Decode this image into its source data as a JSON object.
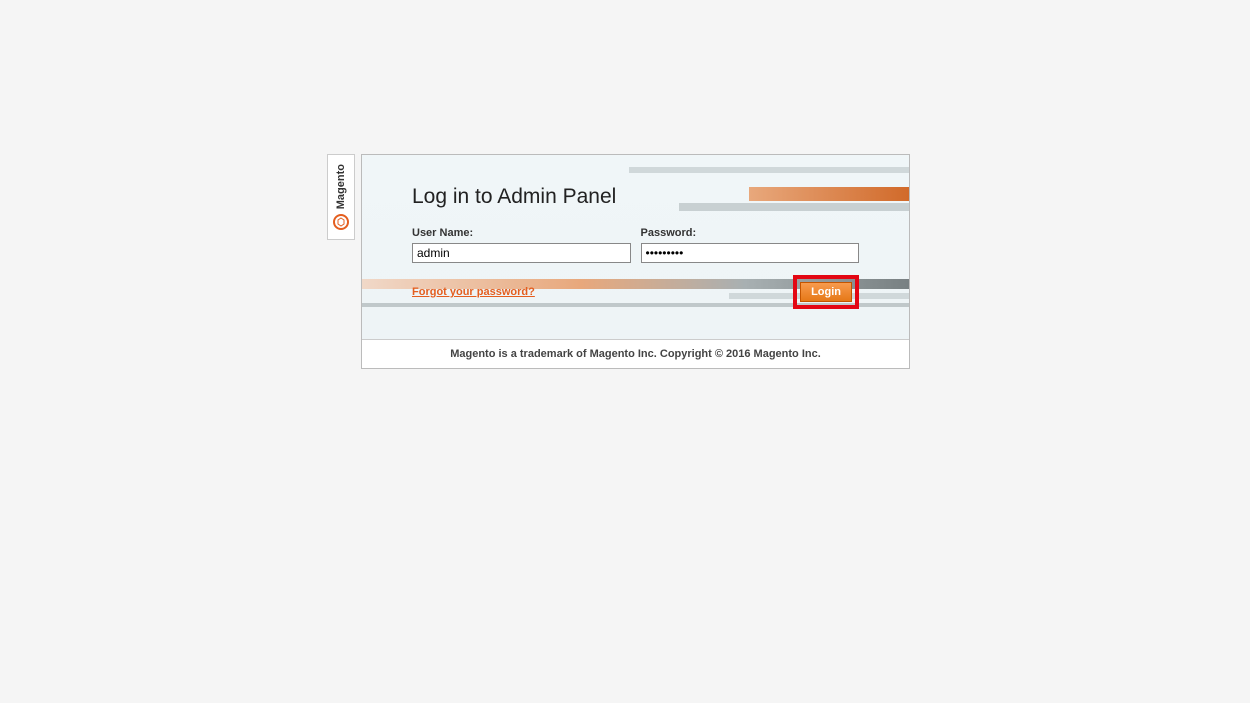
{
  "brand": {
    "name": "Magento"
  },
  "login": {
    "title": "Log in to Admin Panel",
    "username_label": "User Name:",
    "username_value": "admin",
    "password_label": "Password:",
    "password_value": "•••••••••",
    "forgot_link": "Forgot your password?",
    "button_label": "Login"
  },
  "footer": {
    "text": "Magento is a trademark of Magento Inc. Copyright © 2016 Magento Inc."
  }
}
